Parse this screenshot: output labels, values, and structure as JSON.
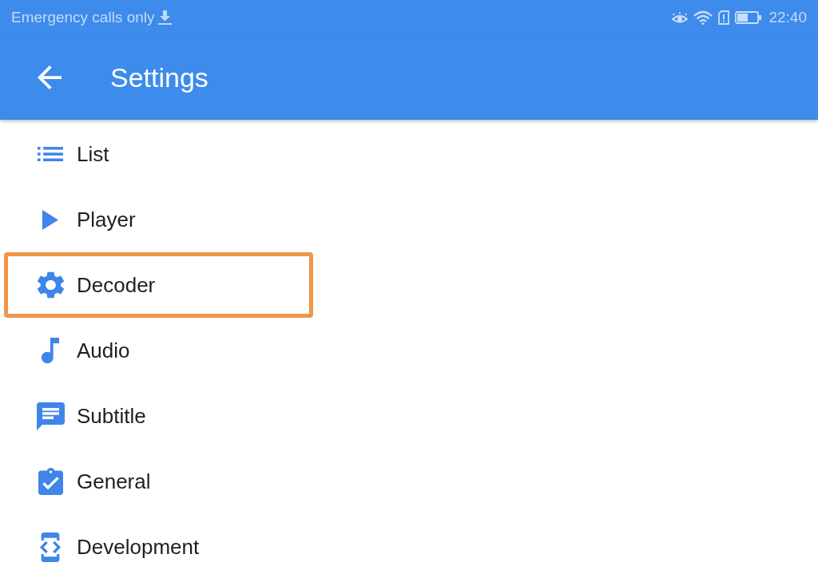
{
  "status_bar": {
    "carrier_text": "Emergency calls only",
    "time": "22:40"
  },
  "app_bar": {
    "title": "Settings"
  },
  "items": [
    {
      "label": "List",
      "highlighted": false
    },
    {
      "label": "Player",
      "highlighted": false
    },
    {
      "label": "Decoder",
      "highlighted": true
    },
    {
      "label": "Audio",
      "highlighted": false
    },
    {
      "label": "Subtitle",
      "highlighted": false
    },
    {
      "label": "General",
      "highlighted": false
    },
    {
      "label": "Development",
      "highlighted": false
    }
  ]
}
